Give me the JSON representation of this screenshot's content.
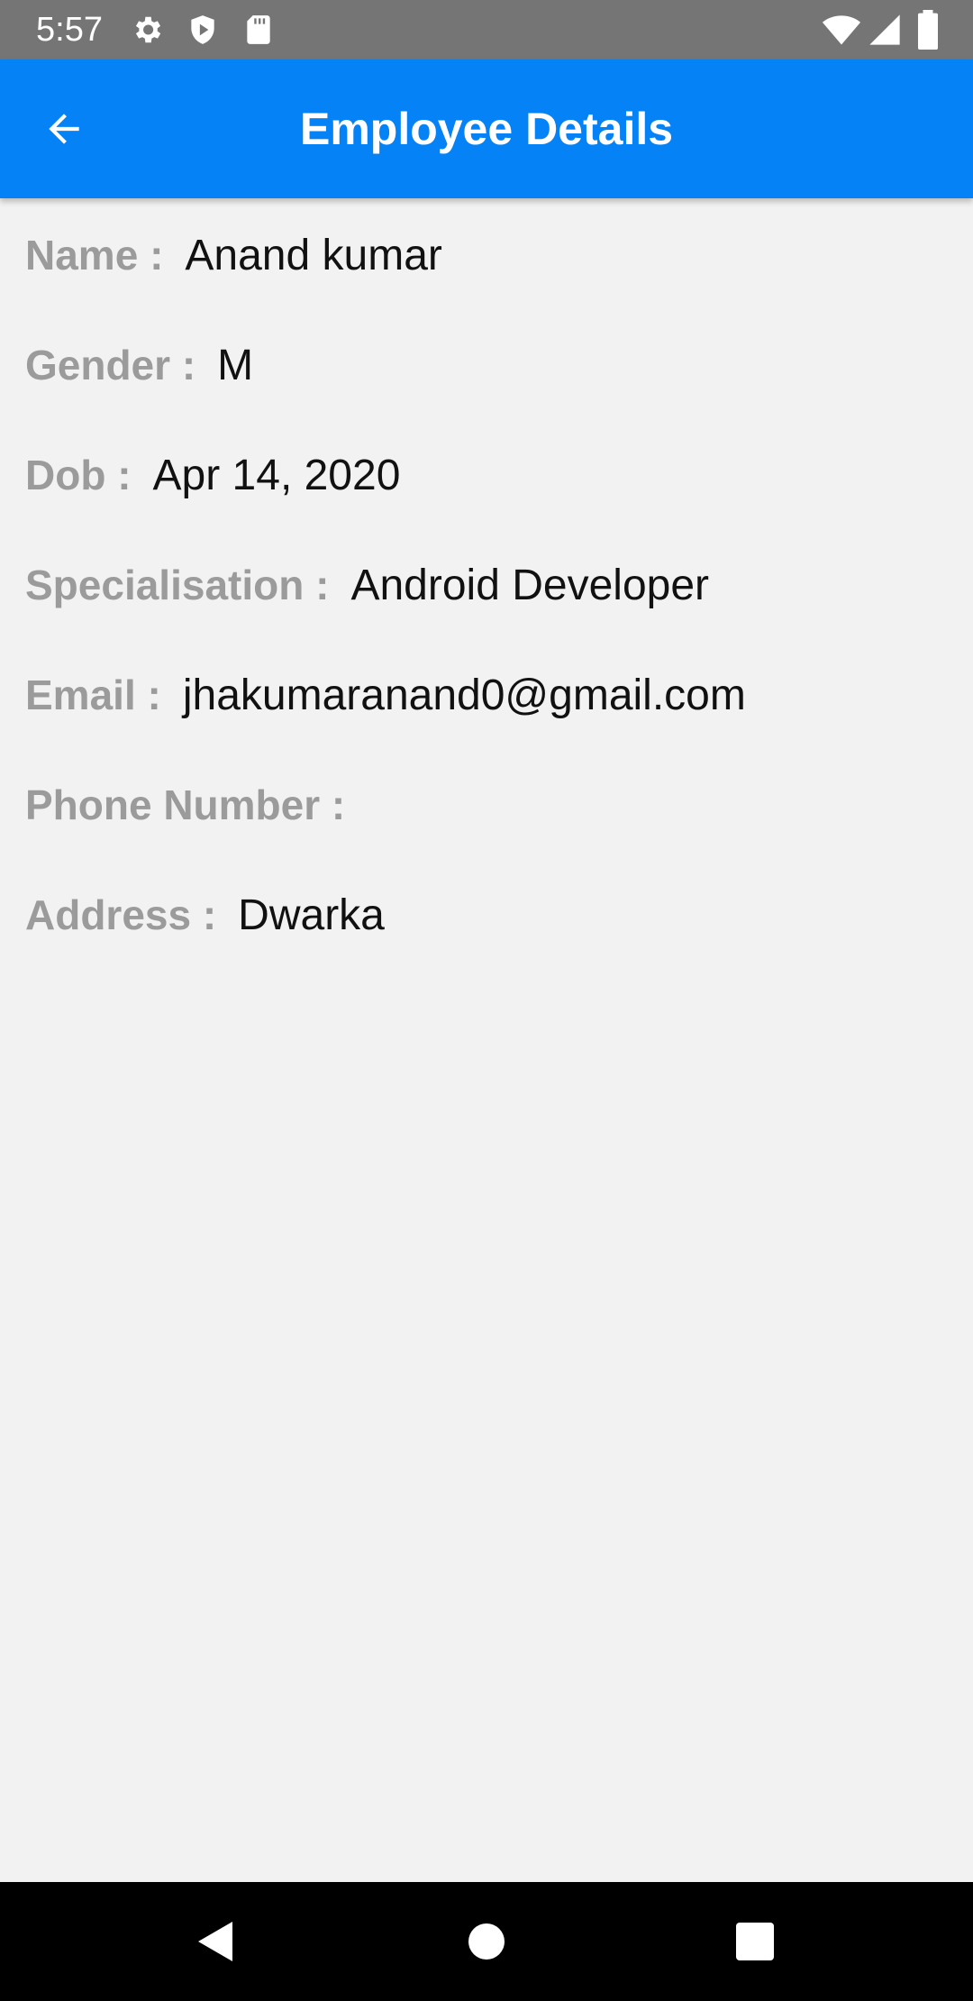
{
  "status_bar": {
    "time": "5:57",
    "icons_left": [
      "gear-icon",
      "shield-play-icon",
      "sd-card-icon"
    ],
    "icons_right": [
      "wifi-icon",
      "signal-icon",
      "battery-icon"
    ]
  },
  "app_bar": {
    "title": "Employee Details",
    "back_icon": "arrow-left-icon",
    "background_color": "#0582f5"
  },
  "details": {
    "name": {
      "label": "Name :",
      "value": "Anand kumar"
    },
    "gender": {
      "label": "Gender :",
      "value": "M"
    },
    "dob": {
      "label": "Dob :",
      "value": "Apr 14, 2020"
    },
    "specialisation": {
      "label": "Specialisation :",
      "value": "Android Developer"
    },
    "email": {
      "label": "Email :",
      "value": "jhakumaranand0@gmail.com"
    },
    "phone": {
      "label": "Phone Number :",
      "value": ""
    },
    "address": {
      "label": "Address :",
      "value": "Dwarka"
    }
  },
  "nav_bar": {
    "buttons": [
      "back-triangle-icon",
      "home-circle-icon",
      "recents-square-icon"
    ]
  },
  "colors": {
    "label": "#9b9b9b",
    "value": "#111111",
    "background": "#f2f2f2"
  }
}
